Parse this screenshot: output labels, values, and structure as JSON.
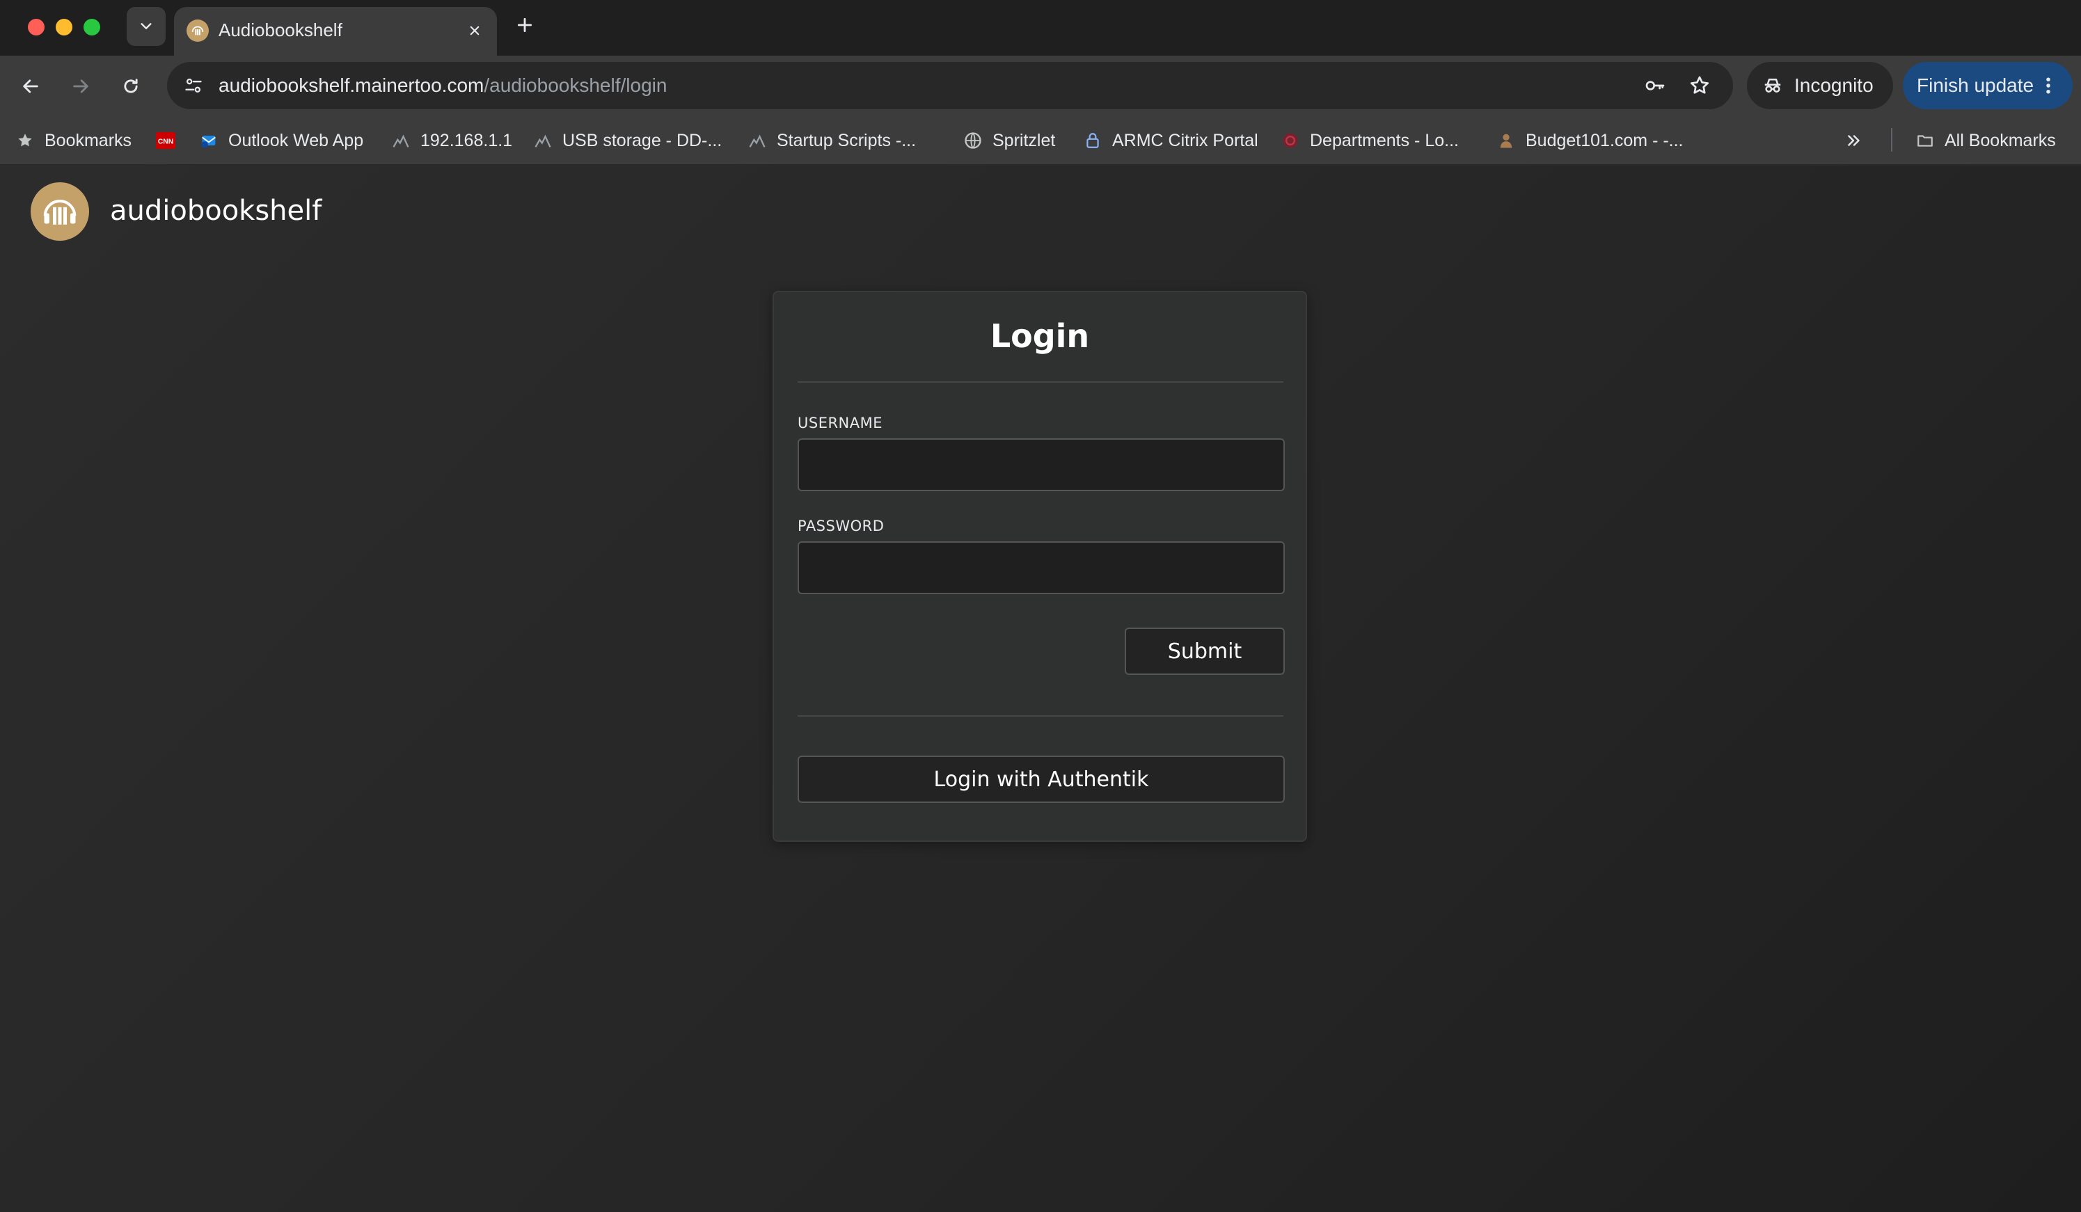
{
  "browser": {
    "tab": {
      "title": "Audiobookshelf"
    },
    "address_bar": {
      "host": "audiobookshelf.mainertoo.com",
      "path": "/audiobookshelf/login"
    },
    "incognito_label": "Incognito",
    "finish_update_label": "Finish update",
    "bookmarks": [
      {
        "label": "Bookmarks",
        "icon": "star-icon"
      },
      {
        "label": "",
        "icon": "cnn-icon"
      },
      {
        "label": "Outlook Web App",
        "icon": "outlook-icon"
      },
      {
        "label": "192.168.1.1",
        "icon": "router-icon"
      },
      {
        "label": "USB storage - DD-...",
        "icon": "router-icon"
      },
      {
        "label": "Startup Scripts -...",
        "icon": "router-icon"
      },
      {
        "label": "Spritzlet",
        "icon": "globe-icon"
      },
      {
        "label": "ARMC Citrix Portal",
        "icon": "lock-icon"
      },
      {
        "label": "Departments - Lo...",
        "icon": "departments-icon"
      },
      {
        "label": "Budget101.com - -...",
        "icon": "budget-icon"
      }
    ],
    "all_bookmarks_label": "All Bookmarks",
    "colors": {
      "finish_update_bg": "#1a4a80",
      "brand_gold": "#c5a16a"
    }
  },
  "app": {
    "name": "audiobookshelf",
    "login": {
      "title": "Login",
      "username_label": "USERNAME",
      "username_value": "",
      "password_label": "PASSWORD",
      "password_value": "",
      "submit_label": "Submit",
      "sso_label": "Login with Authentik"
    }
  }
}
